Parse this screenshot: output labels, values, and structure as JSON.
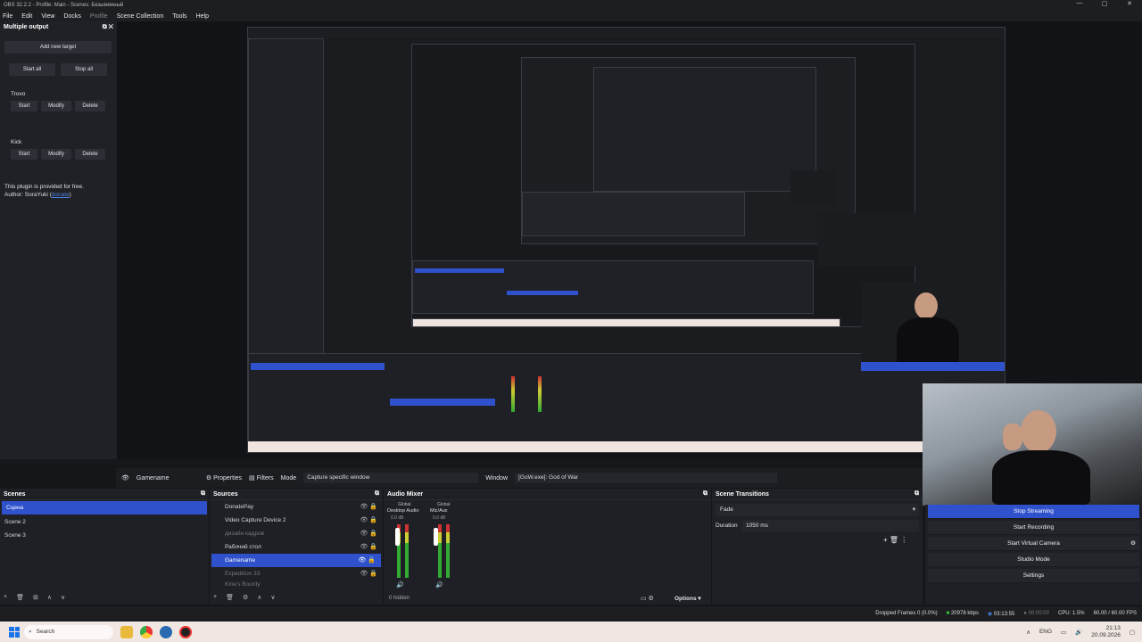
{
  "window": {
    "title": "OBS 32.2.2 - Profile: Main - Scenes: Безымянный",
    "controls": [
      "—",
      "▢",
      "✕"
    ]
  },
  "menu": [
    "File",
    "Edit",
    "View",
    "Docks",
    "Profile",
    "Scene Collection",
    "Tools",
    "Help"
  ],
  "multiple_output": {
    "title": "Multiple output",
    "add_target": "Add new target",
    "start_all": "Start all",
    "stop_all": "Stop all",
    "targets": [
      {
        "name": "Trovo",
        "start": "Start",
        "modify": "Modify",
        "delete": "Delete"
      },
      {
        "name": "Kick",
        "start": "Start",
        "modify": "Modify",
        "delete": "Delete"
      }
    ],
    "note_line1": "This plugin is provided for free.",
    "note_line2_prefix": "Author: SoraYuki (",
    "note_link": "donate",
    "note_line2_suffix": ")"
  },
  "context_bar": {
    "scene_name": "Gamename",
    "properties": "Properties",
    "filters": "Filters",
    "mode_label": "Mode",
    "mode_value": "Capture specific window",
    "window_label": "Window",
    "window_value": "[GoW.exe]: God of War"
  },
  "scenes": {
    "title": "Scenes",
    "items": [
      "Сцена",
      "Scene 2",
      "Scene 3"
    ],
    "selected": 0
  },
  "sources": {
    "title": "Sources",
    "items": [
      {
        "name": "DonatePay",
        "dim": false
      },
      {
        "name": "Video Capture Device 2",
        "dim": false
      },
      {
        "name": "дизайн кадров",
        "dim": true
      },
      {
        "name": "Рабочий стол",
        "dim": false
      },
      {
        "name": "Gamename",
        "dim": false,
        "selected": true
      },
      {
        "name": "Expedition 33",
        "dim": true
      },
      {
        "name": "Kine's Bounty",
        "dim": true
      }
    ]
  },
  "audio_mixer": {
    "title": "Audio Mixer",
    "channels": [
      {
        "tag": "Global",
        "name": "Desktop Audio",
        "db": "0.0 dB",
        "level": 0.45
      },
      {
        "tag": "Global",
        "name": "Mic/Aux",
        "db": "0.0 dB",
        "level": 0.6
      }
    ],
    "hidden": "0 hidden",
    "options": "Options"
  },
  "scene_transitions": {
    "title": "Scene Transitions",
    "transition": "Fade",
    "duration_label": "Duration",
    "duration_value": "1050 ms"
  },
  "controls": {
    "buttons": [
      "Stop Streaming",
      "Start Recording",
      "Start Virtual Camera",
      "Studio Mode",
      "Settings"
    ],
    "active": "Stop Streaming"
  },
  "status": {
    "dropped": "Dropped Frames 0 (0.0%)",
    "bitrate": "20978 kbps",
    "stream_time": "03:13:55",
    "rec_time": "00:00:00",
    "cpu": "CPU: 1.5%",
    "fps": "60.00 / 60.00 FPS"
  },
  "taskbar": {
    "search": "Search",
    "time": "21:13",
    "date": "20.09.2026",
    "lang": "ENG"
  },
  "colors": {
    "accent": "#2f52cc",
    "panel": "#1f2025",
    "background": "#15161a"
  }
}
